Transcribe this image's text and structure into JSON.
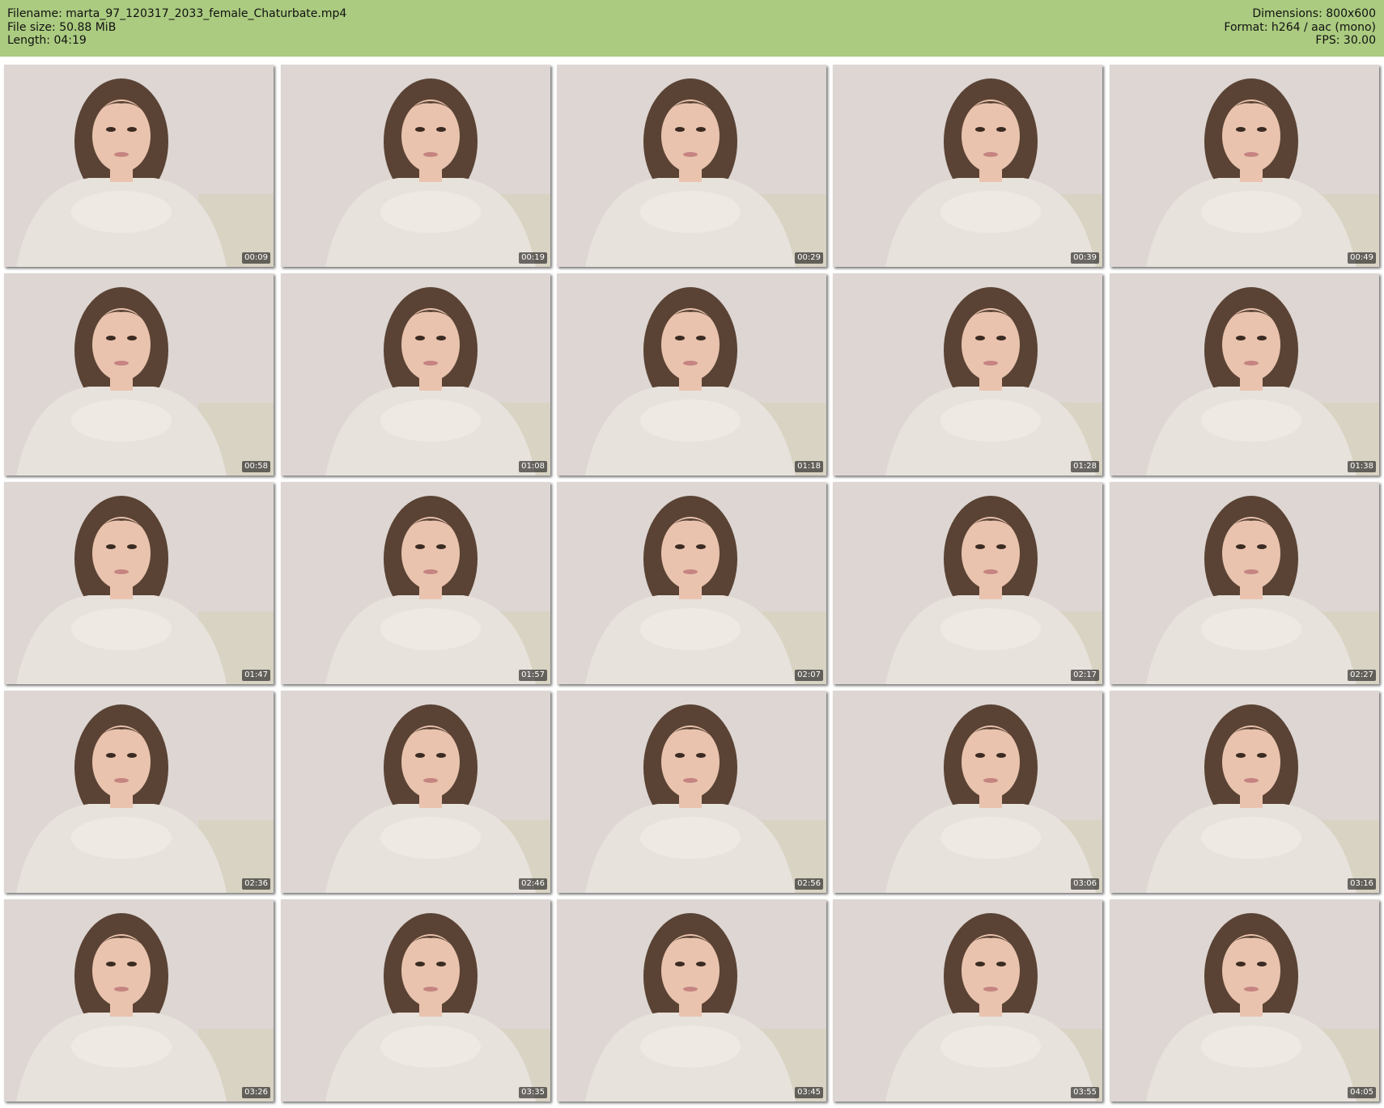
{
  "header": {
    "filename": "Filename: marta_97_120317_2033_female_Chaturbate.mp4",
    "filesize": "File size: 50.88 MiB",
    "length": "Length: 04:19",
    "dimensions": "Dimensions: 800x600",
    "format": "Format: h264 / aac (mono)",
    "fps": "FPS: 30.00"
  },
  "thumbnails": [
    {
      "time": "00:09"
    },
    {
      "time": "00:19"
    },
    {
      "time": "00:29"
    },
    {
      "time": "00:39"
    },
    {
      "time": "00:49"
    },
    {
      "time": "00:58"
    },
    {
      "time": "01:08"
    },
    {
      "time": "01:18"
    },
    {
      "time": "01:28"
    },
    {
      "time": "01:38"
    },
    {
      "time": "01:47"
    },
    {
      "time": "01:57"
    },
    {
      "time": "02:07"
    },
    {
      "time": "02:17"
    },
    {
      "time": "02:27"
    },
    {
      "time": "02:36"
    },
    {
      "time": "02:46"
    },
    {
      "time": "02:56"
    },
    {
      "time": "03:06"
    },
    {
      "time": "03:16"
    },
    {
      "time": "03:26"
    },
    {
      "time": "03:35"
    },
    {
      "time": "03:45"
    },
    {
      "time": "03:55"
    },
    {
      "time": "04:05"
    }
  ],
  "colors": {
    "header_bg": "#abcb80",
    "wall": "#ddd6d3",
    "sweater": "#e8e2dc",
    "hair": "#5a4334",
    "skin": "#e9c3ae"
  }
}
